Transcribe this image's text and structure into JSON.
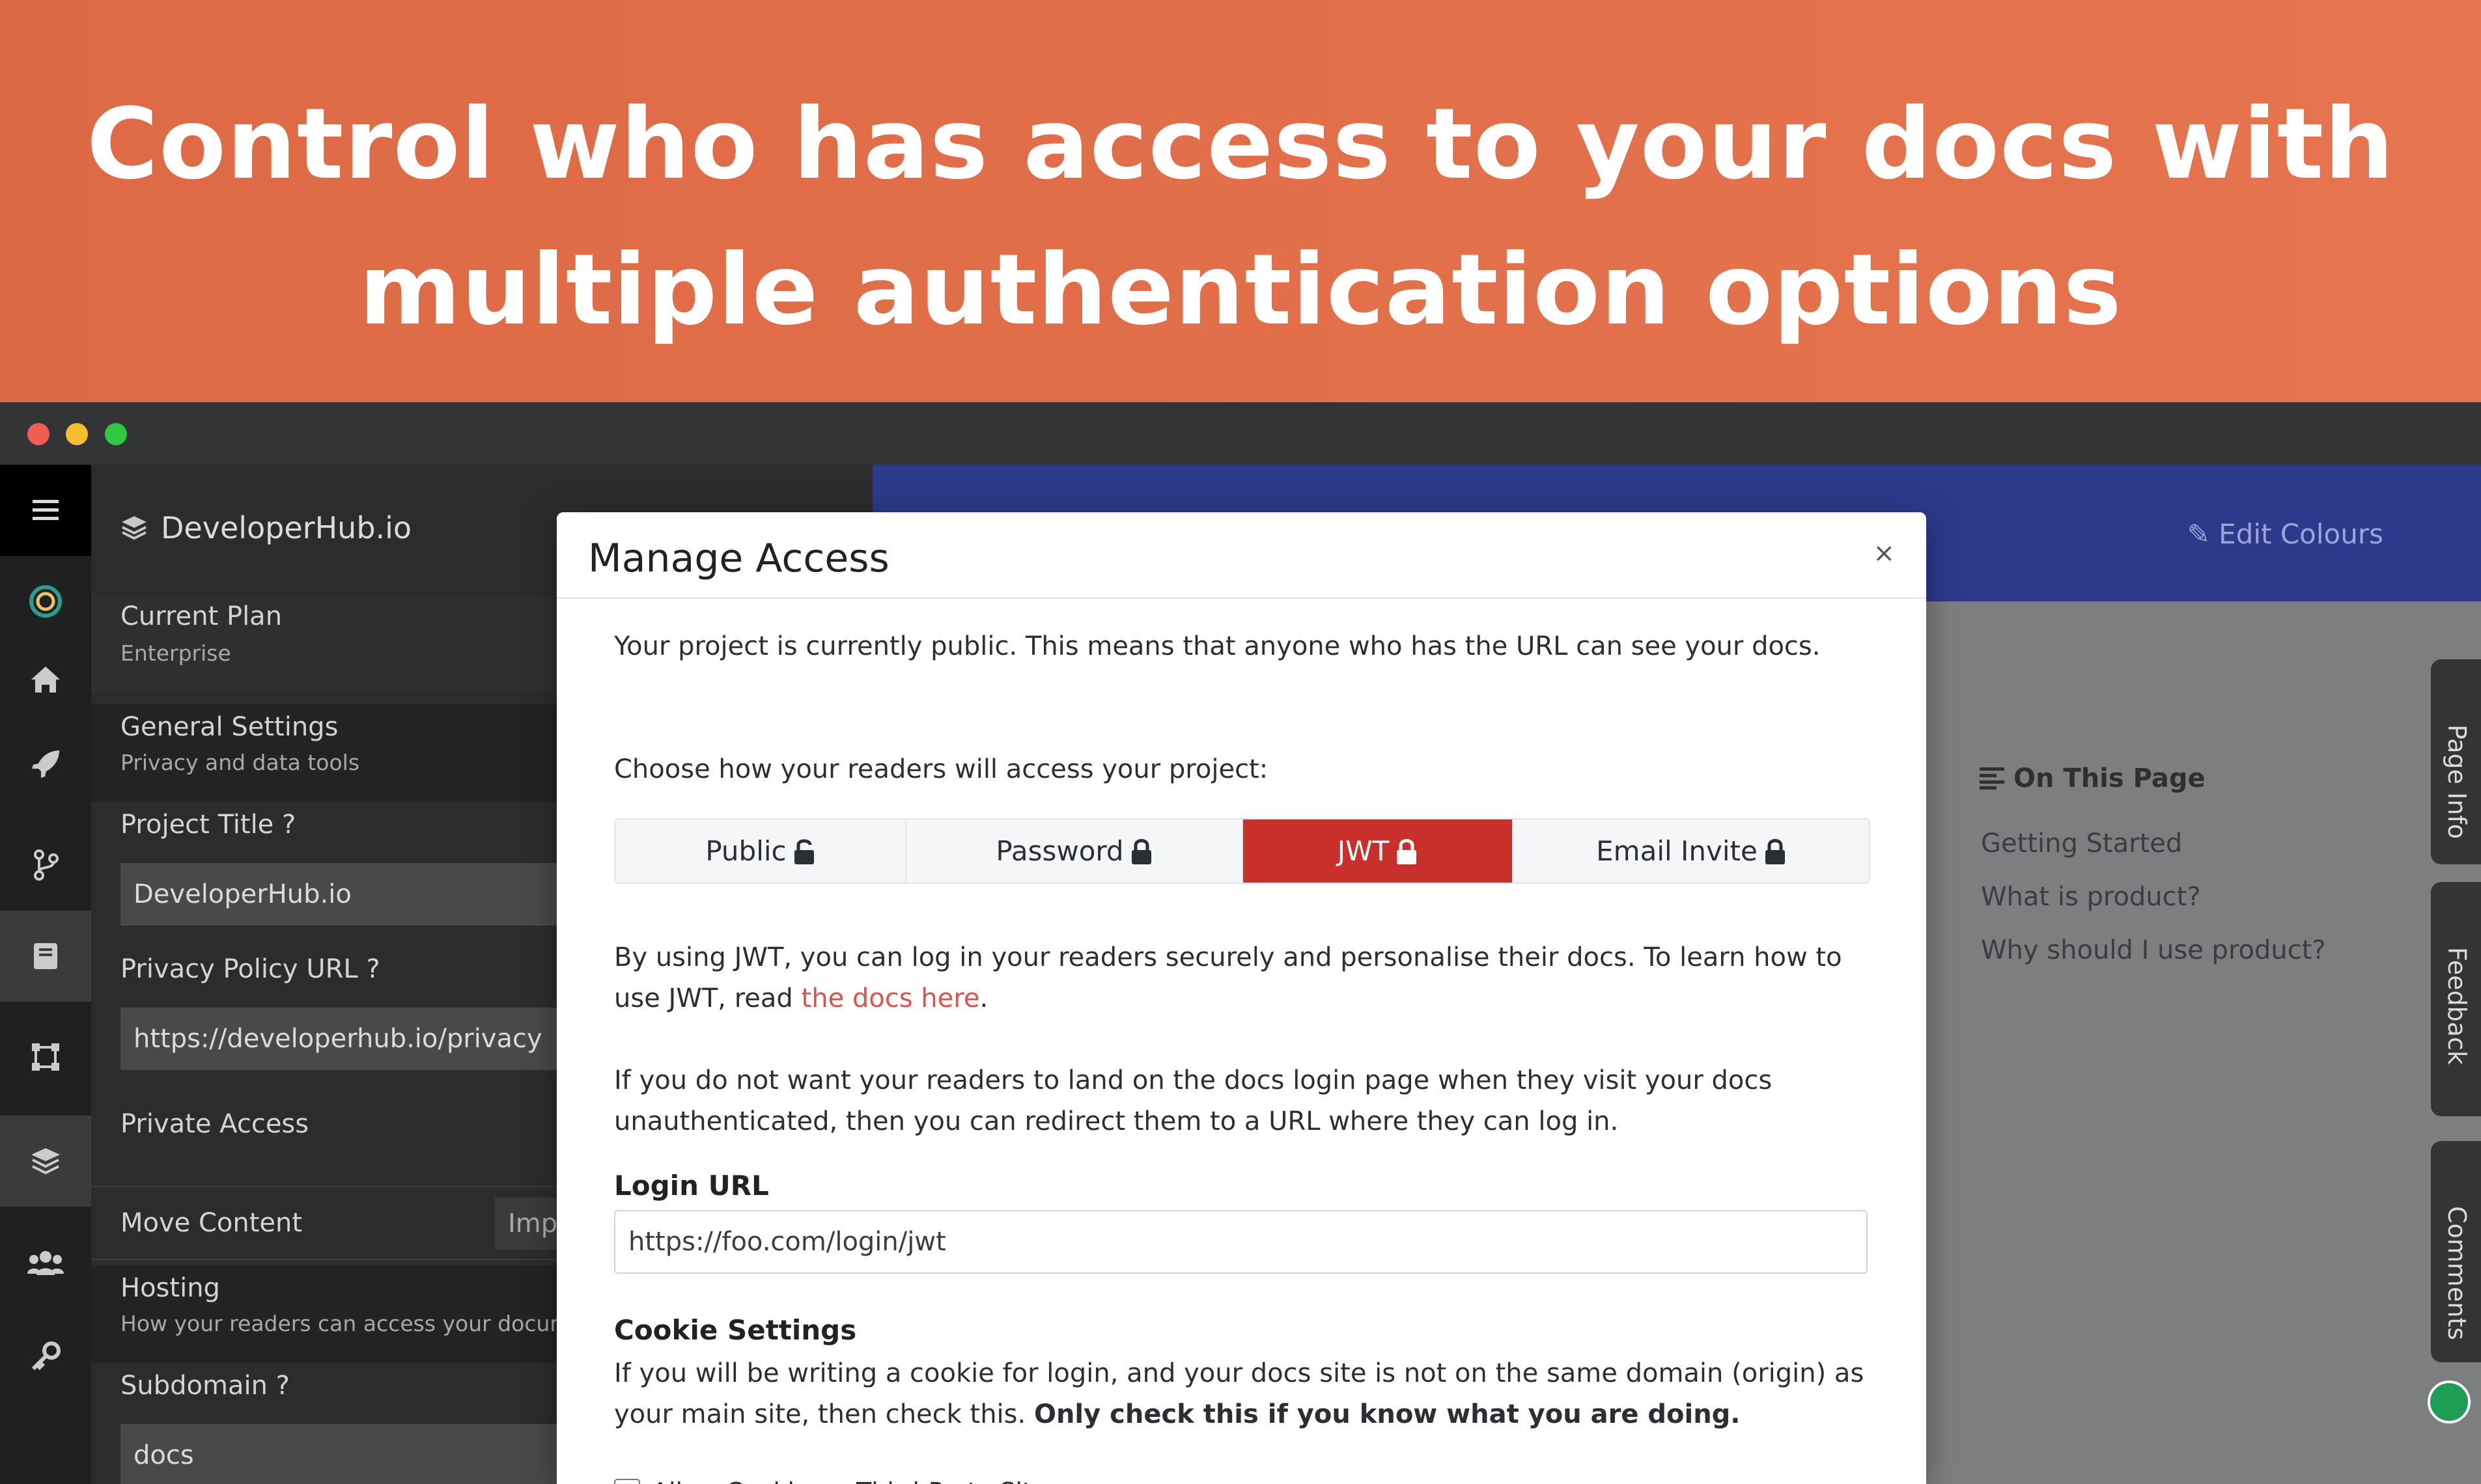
{
  "banner": {
    "line1": "Control who has access to your docs with",
    "line2": "multiple authentication options"
  },
  "sidebar": {
    "brand": "DeveloperHub.io",
    "current_plan": {
      "label": "Current Plan",
      "value": "Enterprise"
    },
    "general_settings": {
      "label": "General Settings",
      "sub": "Privacy and data tools"
    },
    "project_title": {
      "label": "Project Title",
      "value": "DeveloperHub.io"
    },
    "privacy_policy": {
      "label": "Privacy Policy URL",
      "value": "https://developerhub.io/privacy"
    },
    "private_access": "Private Access",
    "move_content": {
      "label": "Move Content",
      "button": "Imp"
    },
    "hosting": {
      "label": "Hosting",
      "sub": "How your readers can access your docum"
    },
    "subdomain": {
      "label": "Subdomain",
      "value": "docs"
    }
  },
  "header": {
    "edit_colours": "Edit Colours"
  },
  "on_this_page": {
    "title": "On This Page",
    "links": [
      "Getting Started",
      "What is product?",
      "Why should I use product?"
    ]
  },
  "side_tabs": {
    "page_info": "Page Info",
    "feedback": "Feedback",
    "comments": "Comments"
  },
  "modal": {
    "title": "Manage Access",
    "close": "×",
    "status_text": "Your project is currently public. This means that anyone who has the URL can see your docs.",
    "choose_text": "Choose how your readers will access your project:",
    "tabs": [
      "Public",
      "Password",
      "JWT",
      "Email Invite"
    ],
    "active_tab": "JWT",
    "jwt_text_before_link": "By using JWT, you can log in your readers securely and personalise their docs. To learn how to use JWT, read ",
    "jwt_link": "the docs here",
    "jwt_text_after_link": ".",
    "redirect_text": "If you do not want your readers to land on the docs login page when they visit your docs unauthenticated, then you can redirect them to a URL where they can log in.",
    "login_url_label": "Login URL",
    "login_url_value": "https://foo.com/login/jwt",
    "cookie_label": "Cookie Settings",
    "cookie_text": "If you will be writing a cookie for login, and your docs site is not on the same domain (origin) as your main site, then check this. ",
    "cookie_text_bold": "Only check this if you know what you are doing.",
    "cookie_checkbox": "Allow Cookie on Third-Party Sites"
  },
  "colors": {
    "banner": "#e06d48",
    "active_tab": "#c9302c",
    "header_blue": "#2d3a8c",
    "link": "#d9534f"
  }
}
